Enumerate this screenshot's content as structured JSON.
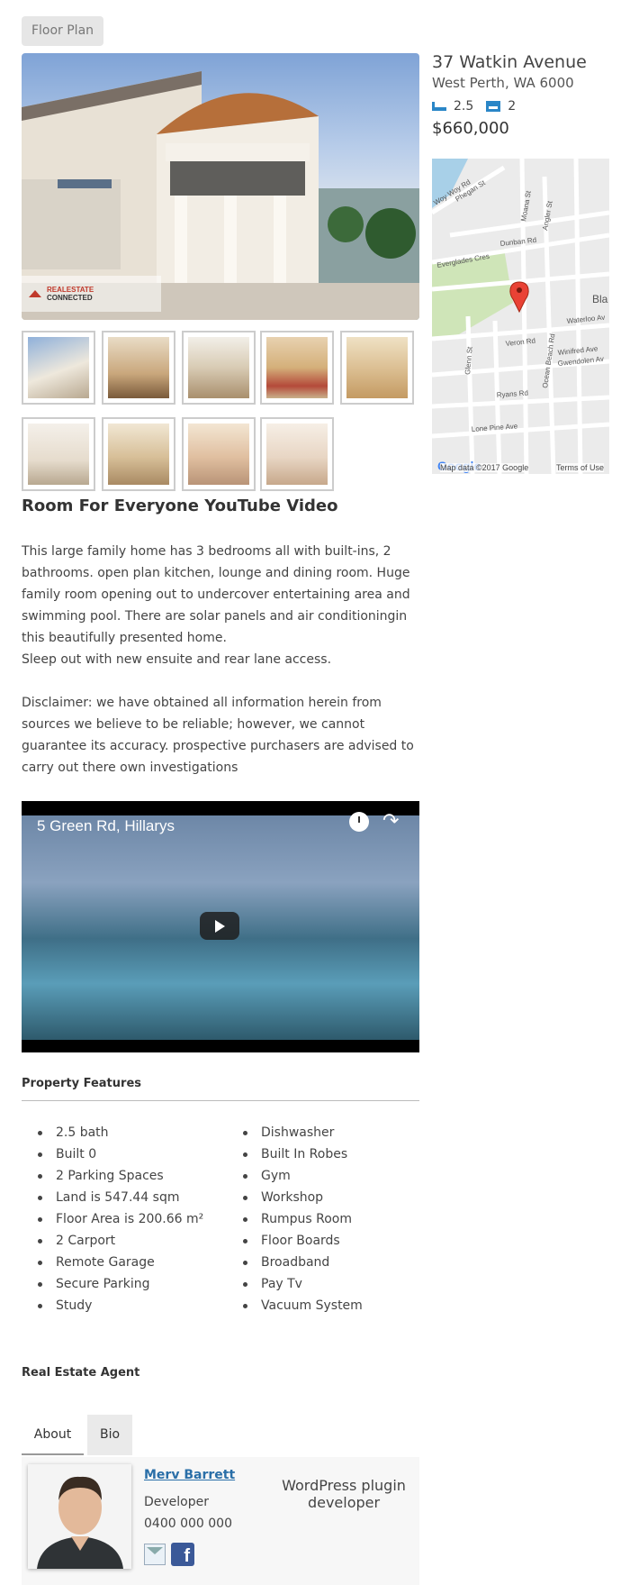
{
  "buttons": {
    "floor_plan": "Floor Plan"
  },
  "hero": {
    "logo_text_a": "REALESTATE",
    "logo_text_b": "CONNECTED"
  },
  "listing": {
    "address": "37 Watkin Avenue",
    "suburb": "West Perth, WA 6000",
    "baths": "2.5",
    "beds": "2",
    "price": "$660,000"
  },
  "map": {
    "streets": [
      "Woy Woy Rd",
      "Phegan St",
      "Moana St",
      "Angler St",
      "Dunban Rd",
      "Everglades Cres",
      "Waterloo Av",
      "Veron Rd",
      "Winifred Ave",
      "Gwendolen Av",
      "Glenn St",
      "Ocean Beach Rd",
      "Ryans Rd",
      "Lone Pine Ave",
      "Bla"
    ],
    "google": "Google",
    "map_data": "Map data ©2017 Google",
    "terms": "Terms of Use"
  },
  "video_section": {
    "title": "Room For Everyone YouTube Video"
  },
  "description": {
    "para1": "This large family home has 3 bedrooms all with built-ins, 2 bathrooms. open plan kitchen, lounge and dining room. Huge family room opening out to undercover entertaining area and swimming pool. There are solar panels and air conditioningin this beautifully presented home.",
    "para2": "Sleep out with new ensuite and rear lane access.",
    "para3": "Disclaimer: we have obtained all information herein from sources we believe to be reliable; however, we cannot guarantee its accuracy. prospective purchasers are advised to carry out there own investigations"
  },
  "video": {
    "caption": "5 Green Rd, Hillarys",
    "share": "↷"
  },
  "features": {
    "title": "Property Features",
    "left": [
      "2.5 bath",
      "Built 0",
      "2 Parking Spaces",
      "Land is 547.44 sqm",
      "Floor Area is 200.66 m²",
      "2 Carport",
      "Remote Garage",
      "Secure Parking",
      "Study"
    ],
    "right": [
      "Dishwasher",
      "Built In Robes",
      "Gym",
      "Workshop",
      "Rumpus Room",
      "Floor Boards",
      "Broadband",
      "Pay Tv",
      "Vacuum System"
    ]
  },
  "agent": {
    "title": "Real Estate Agent",
    "tabs": [
      "About",
      "Bio"
    ],
    "name": "Merv Barrett",
    "role": "Developer",
    "phone": "0400 000 000",
    "facebook_glyph": "f",
    "bio": "WordPress plugin developer"
  }
}
